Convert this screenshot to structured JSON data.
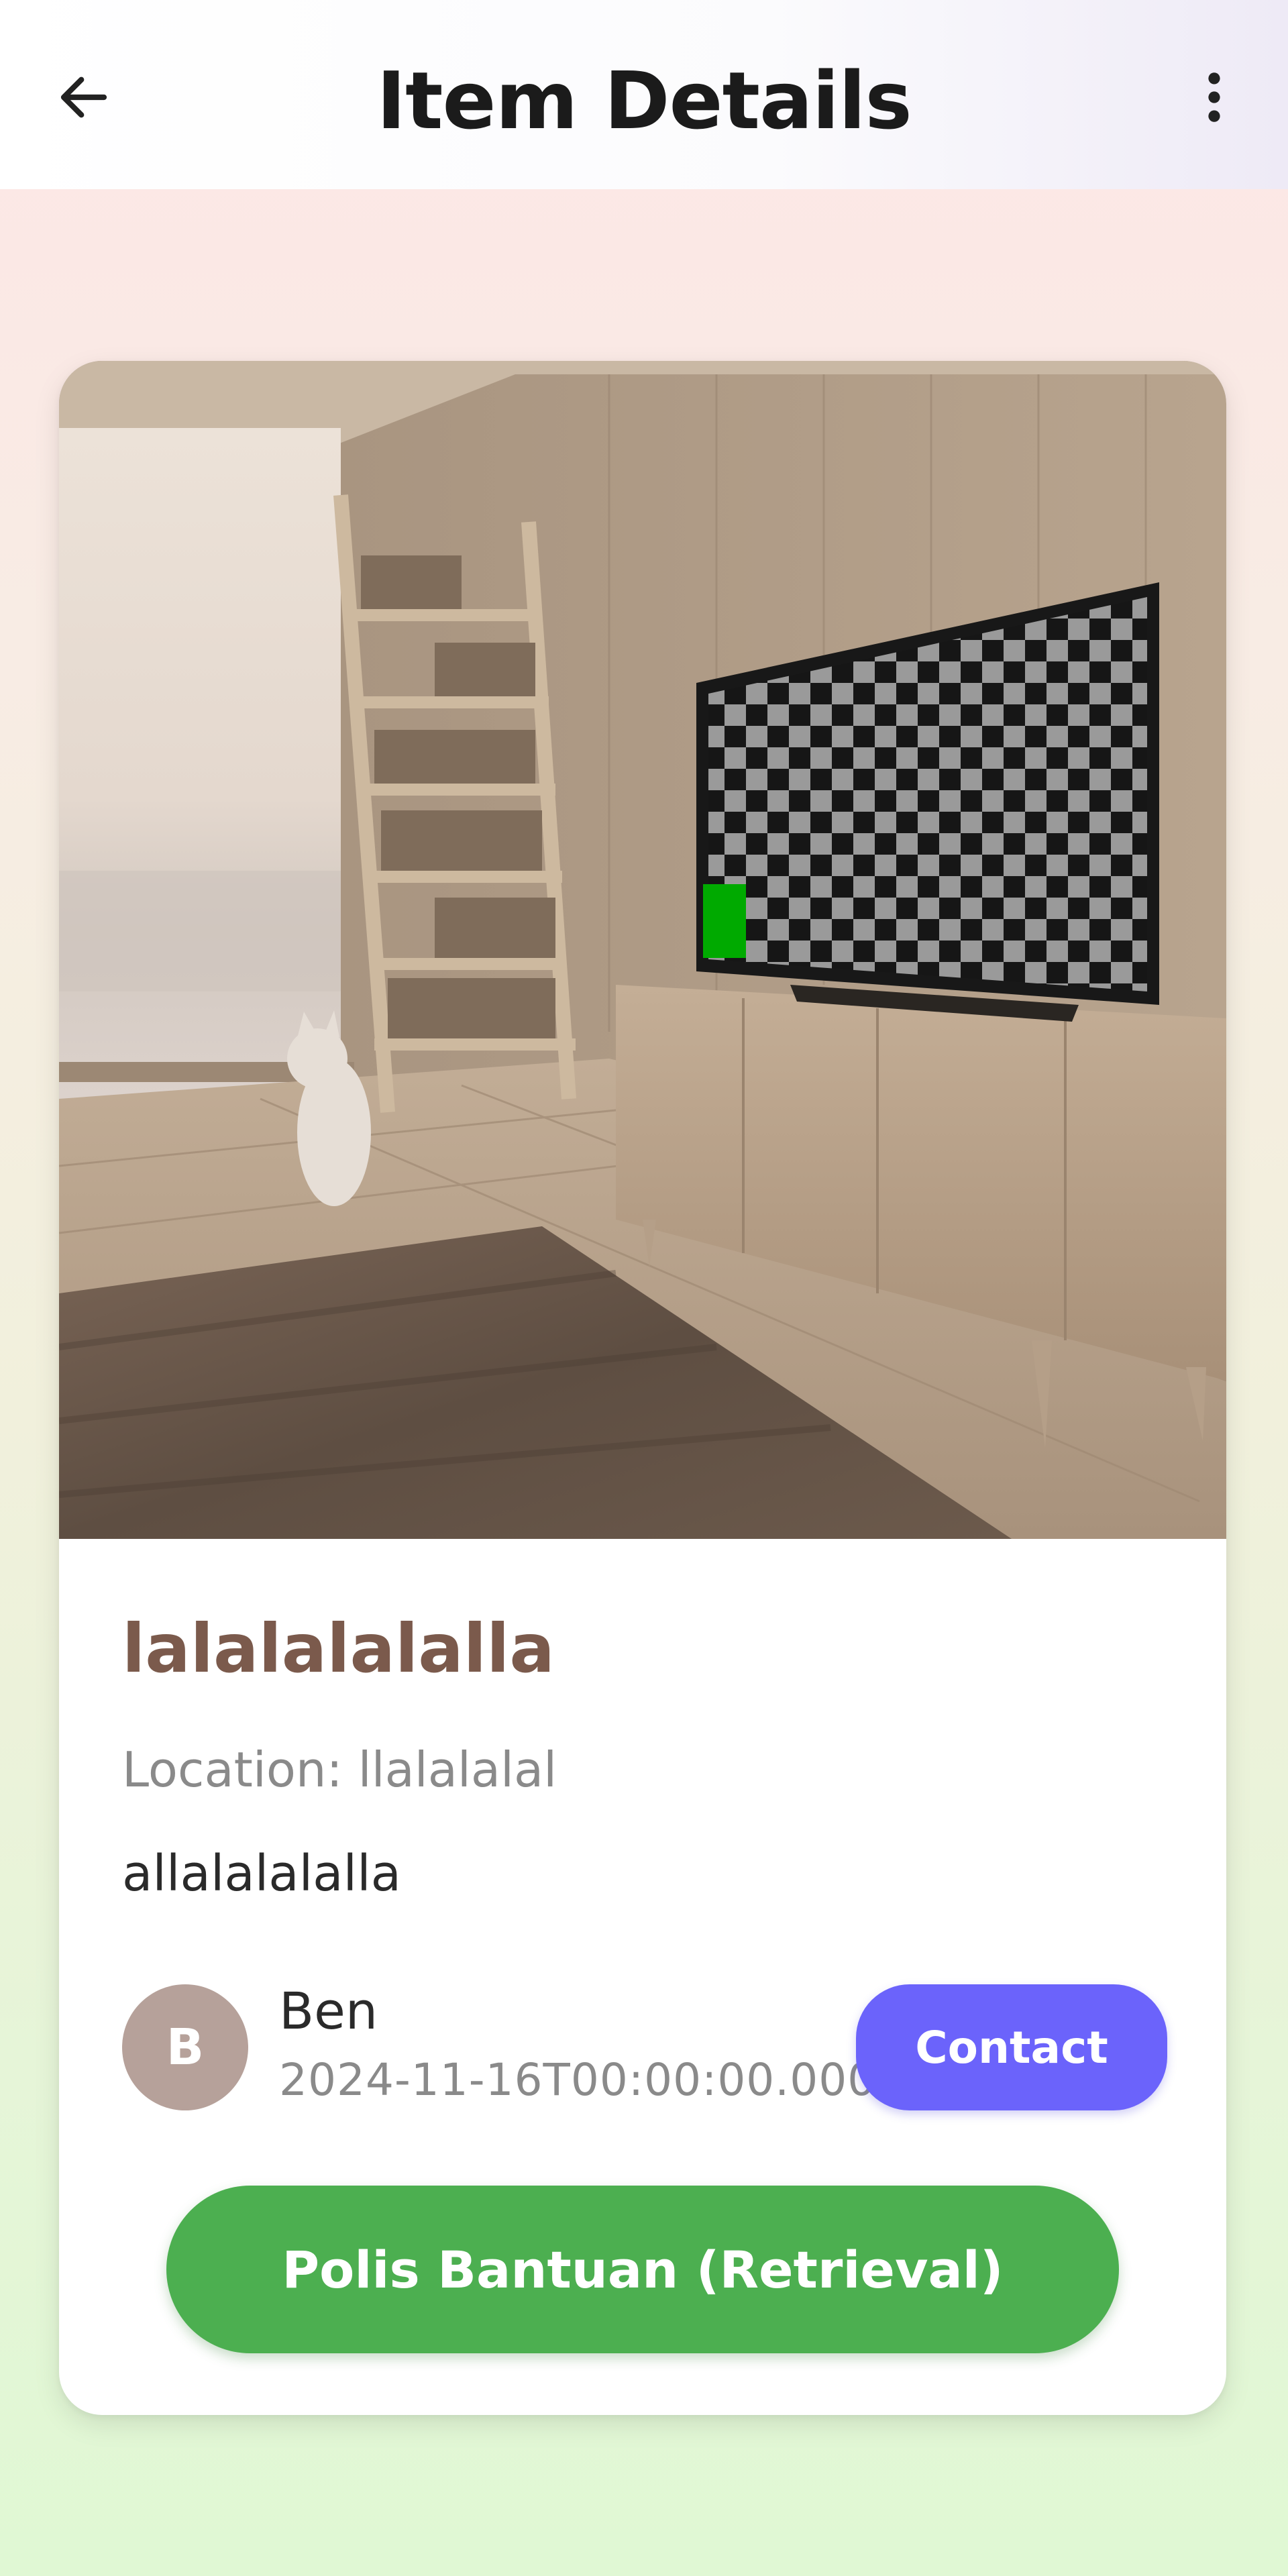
{
  "appbar": {
    "title": "Item Details",
    "back_icon": "arrow-left-icon",
    "more_icon": "more-vertical-icon"
  },
  "item": {
    "name": "lalalalalalla",
    "location": "Location: llalalalal",
    "description": "allalalalalla"
  },
  "poster": {
    "avatar_initial": "B",
    "name": "Ben",
    "date": "2024-11-16T00:00:00.000"
  },
  "actions": {
    "contact_label": "Contact",
    "polis_label": "Polis Bantuan (Retrieval)"
  },
  "colors": {
    "title_brown": "#7b5a4c",
    "contact_purple": "#6b63fb",
    "polis_green": "#4caf50",
    "avatar_bg": "#b6a19a"
  }
}
